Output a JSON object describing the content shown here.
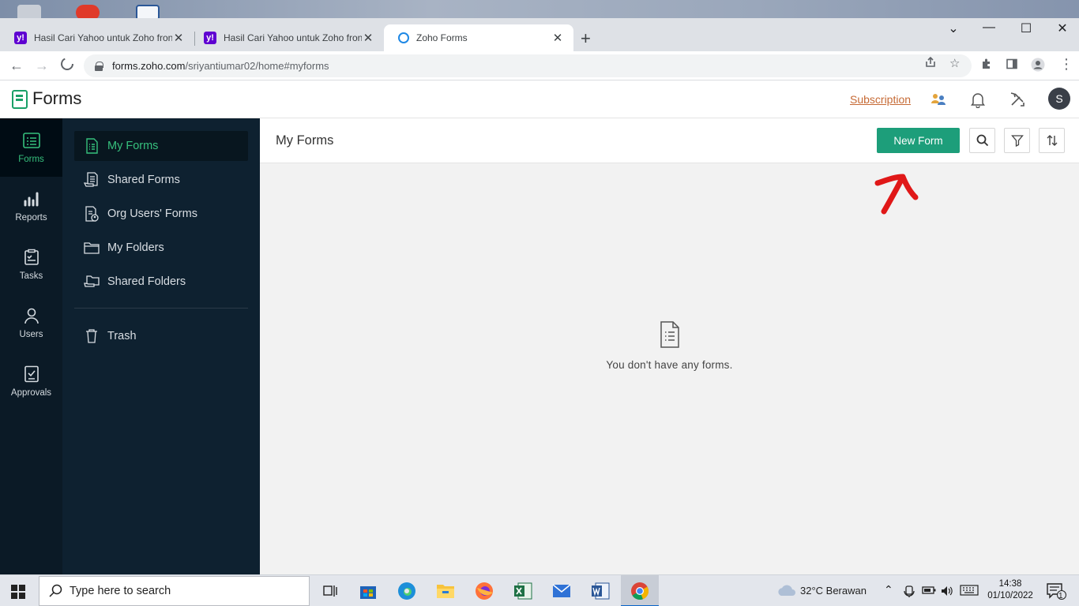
{
  "browser": {
    "tabs": [
      {
        "title": "Hasil Cari Yahoo untuk Zoho fron",
        "favicon": "yahoo-icon"
      },
      {
        "title": "Hasil Cari Yahoo untuk Zoho fron",
        "favicon": "yahoo-icon"
      },
      {
        "title": "Zoho Forms",
        "favicon": "zoho-forms-icon",
        "active": true
      }
    ],
    "url_host": "forms.zoho.com",
    "url_path": "/sriyantiumar02/home#myforms"
  },
  "app": {
    "title": "Forms",
    "subscription_label": "Subscription",
    "avatar_initial": "S",
    "accent": "#1d9e7a"
  },
  "rail": [
    {
      "label": "Forms",
      "icon": "forms-icon",
      "active": true
    },
    {
      "label": "Reports",
      "icon": "reports-icon"
    },
    {
      "label": "Tasks",
      "icon": "tasks-icon"
    },
    {
      "label": "Users",
      "icon": "users-icon"
    },
    {
      "label": "Approvals",
      "icon": "approvals-icon"
    }
  ],
  "sidebar": [
    {
      "label": "My Forms",
      "icon": "my-forms-icon",
      "active": true
    },
    {
      "label": "Shared Forms",
      "icon": "shared-forms-icon"
    },
    {
      "label": "Org Users' Forms",
      "icon": "org-users-forms-icon"
    },
    {
      "label": "My Folders",
      "icon": "folder-icon"
    },
    {
      "label": "Shared Folders",
      "icon": "shared-folder-icon"
    },
    {
      "label": "Trash",
      "icon": "trash-icon"
    }
  ],
  "main": {
    "title": "My Forms",
    "new_form_label": "New Form",
    "empty_message": "You don't have any forms."
  },
  "taskbar": {
    "search_placeholder": "Type here to search",
    "weather": "32°C  Berawan",
    "time": "14:38",
    "date": "01/10/2022",
    "notification_count": "1"
  }
}
